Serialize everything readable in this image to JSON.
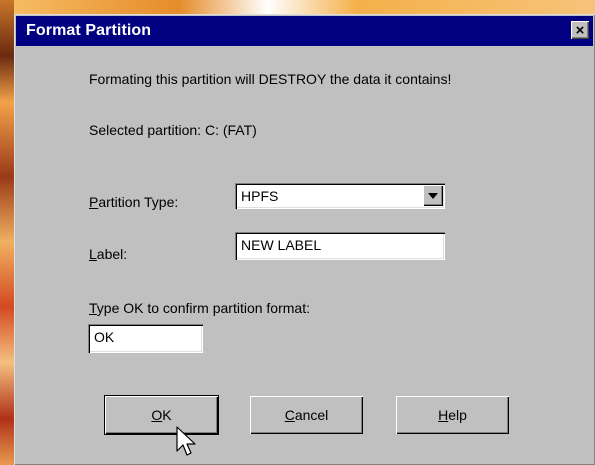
{
  "dialog": {
    "title": "Format Partition",
    "close_label": "×",
    "warning": "Formating this partition will DESTROY the data it contains!",
    "selected_partition": "Selected partition: C:  (FAT)",
    "partition_type": {
      "label_first": "P",
      "label_rest": "artition Type:",
      "value": "HPFS"
    },
    "volume_label": {
      "label_first": "L",
      "label_rest": "abel:",
      "value": "NEW LABEL"
    },
    "confirm": {
      "label_first": "T",
      "label_rest": "ype OK to confirm partition format:",
      "value": "OK"
    },
    "buttons": {
      "ok": {
        "first": "O",
        "rest": "K"
      },
      "cancel": {
        "first": "C",
        "rest": "ancel"
      },
      "help": {
        "first": "H",
        "rest": "elp"
      }
    }
  },
  "colors": {
    "titlebar": "#000080",
    "face": "#c0c0c0"
  },
  "icons": {
    "close": "close-icon",
    "dropdown": "chevron-down-icon",
    "cursor": "mouse-pointer-icon"
  }
}
